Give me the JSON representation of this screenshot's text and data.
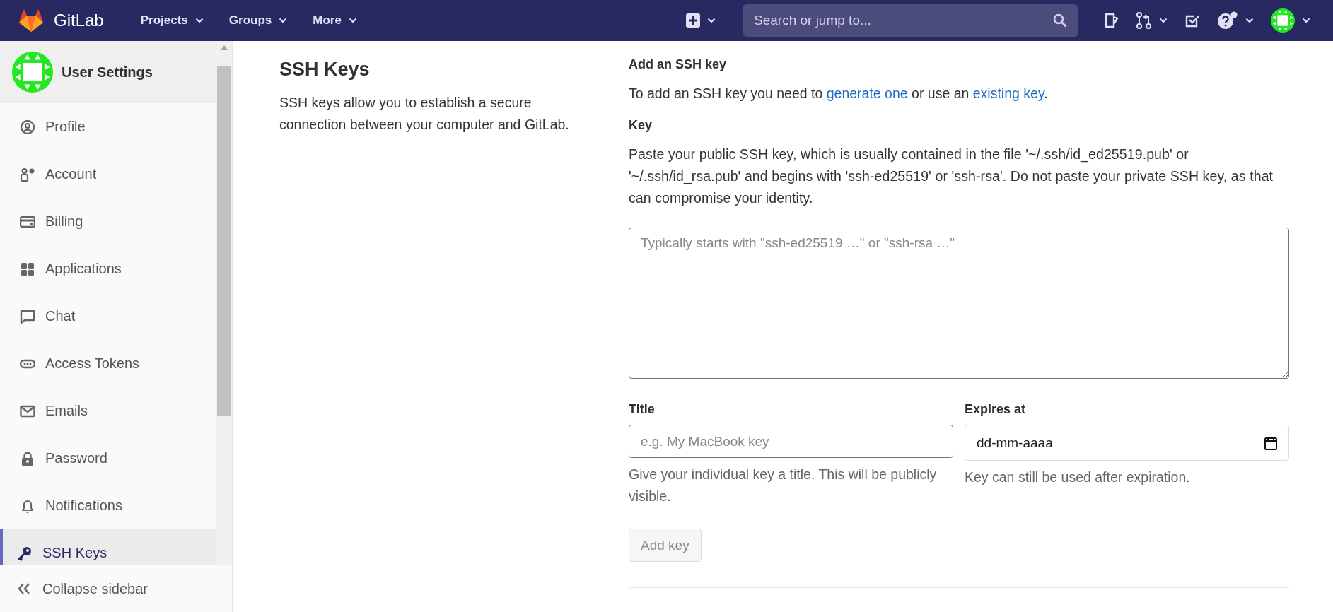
{
  "header": {
    "brand": "GitLab",
    "nav": [
      {
        "label": "Projects"
      },
      {
        "label": "Groups"
      },
      {
        "label": "More"
      }
    ],
    "search": {
      "placeholder": "Search or jump to..."
    }
  },
  "sidebar": {
    "title": "User Settings",
    "items": [
      {
        "label": "Profile",
        "selected": false
      },
      {
        "label": "Account",
        "selected": false
      },
      {
        "label": "Billing",
        "selected": false
      },
      {
        "label": "Applications",
        "selected": false
      },
      {
        "label": "Chat",
        "selected": false
      },
      {
        "label": "Access Tokens",
        "selected": false
      },
      {
        "label": "Emails",
        "selected": false
      },
      {
        "label": "Password",
        "selected": false
      },
      {
        "label": "Notifications",
        "selected": false
      },
      {
        "label": "SSH Keys",
        "selected": true
      }
    ],
    "collapse": "Collapse sidebar"
  },
  "page": {
    "title": "SSH Keys",
    "description": "SSH keys allow you to establish a secure connection between your computer and GitLab."
  },
  "form": {
    "heading": "Add an SSH key",
    "intro": {
      "before": "To add an SSH key you need to ",
      "link_1": "generate one",
      "middle": " or use an ",
      "link_2": "existing key",
      "after": "."
    },
    "key_label": "Key",
    "key_help": "Paste your public SSH key, which is usually contained in the file '~/.ssh/id_ed25519.pub' or '~/.ssh/id_rsa.pub' and begins with 'ssh-ed25519' or 'ssh-rsa'. Do not paste your private SSH key, as that can compromise your identity.",
    "key_field": {
      "placeholder": "Typically starts with \"ssh-ed25519 …\" or \"ssh-rsa …\""
    },
    "title_label": "Title",
    "title_field": {
      "placeholder": "e.g. My MacBook key"
    },
    "title_help": "Give your individual key a title. This will be publicly visible.",
    "expires_label": "Expires at",
    "expires_field": {
      "value": "dd-mm-aaaa"
    },
    "expires_help": "Key can still be used after expiration.",
    "submit": {
      "label": "Add key",
      "disabled": true
    }
  }
}
